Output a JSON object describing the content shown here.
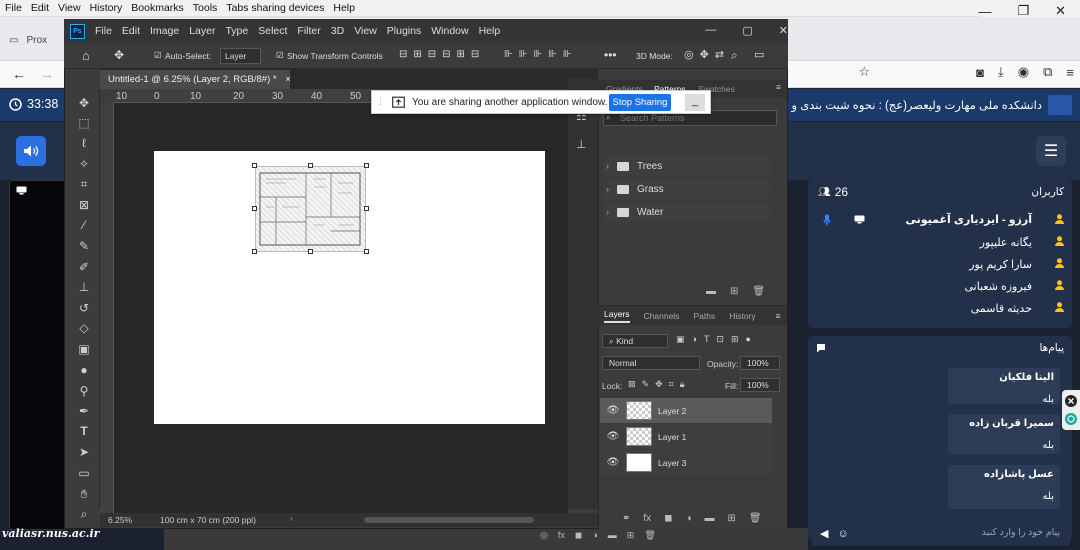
{
  "browser": {
    "menu": [
      "File",
      "Edit",
      "View",
      "History",
      "Bookmarks",
      "Tools",
      "Tabs sharing devices",
      "Help"
    ],
    "tab_label": "Prox"
  },
  "app": {
    "clock": "33:38",
    "title": "دانشکده ملی مهارت ولیعصر(عج) : نحوه شیت بندی و ترس",
    "users_count": "26",
    "users_label": "کاربران",
    "users": [
      "آرزو - ایزدیاری آغمیونی",
      "یگانه علیپور",
      "سارا کریم پور",
      "فیروزه شعبانی",
      "حدیثه قاسمی"
    ],
    "messages_label": "پیام‌ها",
    "messages": [
      {
        "name": "الینا فلکیان",
        "text": "بله"
      },
      {
        "name": "سمیرا قربان زاده",
        "text": "بله"
      },
      {
        "name": "عسل پاشازاده",
        "text": "بله"
      }
    ],
    "input_placeholder": "پیام خود را وارد کنید",
    "watermark": "valiasr.nus.ac.ir"
  },
  "ps": {
    "logo": "Ps",
    "menu": [
      "File",
      "Edit",
      "Image",
      "Layer",
      "Type",
      "Select",
      "Filter",
      "3D",
      "View",
      "Plugins",
      "Window",
      "Help"
    ],
    "options": {
      "auto_select": "Auto-Select:",
      "auto_select_value": "Layer",
      "show_transform": "Show Transform Controls",
      "mode_3d": "3D Mode:"
    },
    "doc_tab": "Untitled-1 @ 6.25% (Layer 2, RGB/8#) *",
    "ruler": [
      "10",
      "0",
      "10",
      "20",
      "30",
      "40",
      "50"
    ],
    "status_zoom": "6.25%",
    "status_size": "100 cm x 70 cm (200 ppi)",
    "lib_tabs": [
      "Gradients",
      "Patterns",
      "Swatches"
    ],
    "search_placeholder": "Search Patterns",
    "folders": [
      "Trees",
      "Grass",
      "Water"
    ],
    "layer_tabs": [
      "Layers",
      "Channels",
      "Paths",
      "History"
    ],
    "kind": "Kind",
    "blend": "Normal",
    "opacity_label": "Opacity:",
    "opacity": "100%",
    "lock_label": "Lock:",
    "fill_label": "Fill:",
    "fill": "100%",
    "layers": [
      "Layer 2",
      "Layer 1",
      "Layer 3"
    ]
  },
  "share": {
    "text": "You are sharing another application window.",
    "stop": "Stop Sharing",
    "minimize": "_"
  },
  "colors": {
    "accent": "#1a73e8",
    "app_bg": "#1c2130",
    "panel": "#223049",
    "ps_blue": "#31a8ff"
  }
}
